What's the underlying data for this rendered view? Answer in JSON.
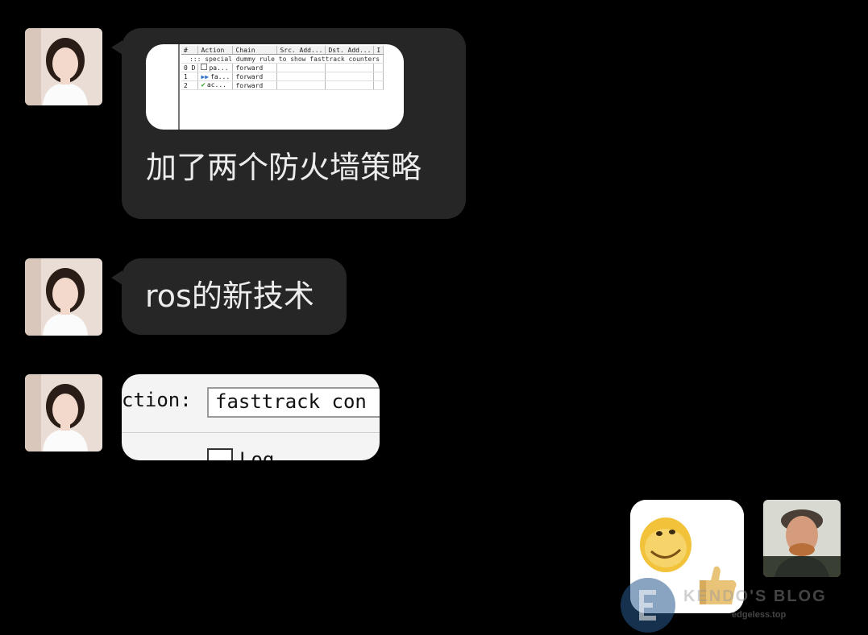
{
  "messages": [
    {
      "sender": "other",
      "image": {
        "headers": [
          "#",
          "Action",
          "Chain",
          "Src. Add...",
          "Dst. Add...",
          "I"
        ],
        "comment": "::: special dummy rule to show fasttrack counters",
        "rows": [
          [
            "0 D",
            "pa...",
            "forward"
          ],
          [
            "1",
            "fa...",
            "forward"
          ],
          [
            "2",
            "ac...",
            "forward"
          ]
        ]
      },
      "text": "加了两个防火墙策略"
    },
    {
      "sender": "other",
      "text": "ros的新技术"
    },
    {
      "sender": "other",
      "image": {
        "field_label": "ction:",
        "field_value": "fasttrack con",
        "checkbox_label": "Log"
      }
    },
    {
      "sender": "self",
      "sticker": "thumbs-up-face-sticker"
    }
  ],
  "icons": {
    "rule_passthrough": "checkbox-icon",
    "rule_fasttrack": "double-arrow-icon",
    "rule_accept": "green-check-icon"
  },
  "colors": {
    "background": "#000000",
    "bubble": "#262626",
    "text": "#ececec"
  },
  "watermark": {
    "title": "KENDO'S BLOG",
    "subtitle": "edgeless.top"
  }
}
